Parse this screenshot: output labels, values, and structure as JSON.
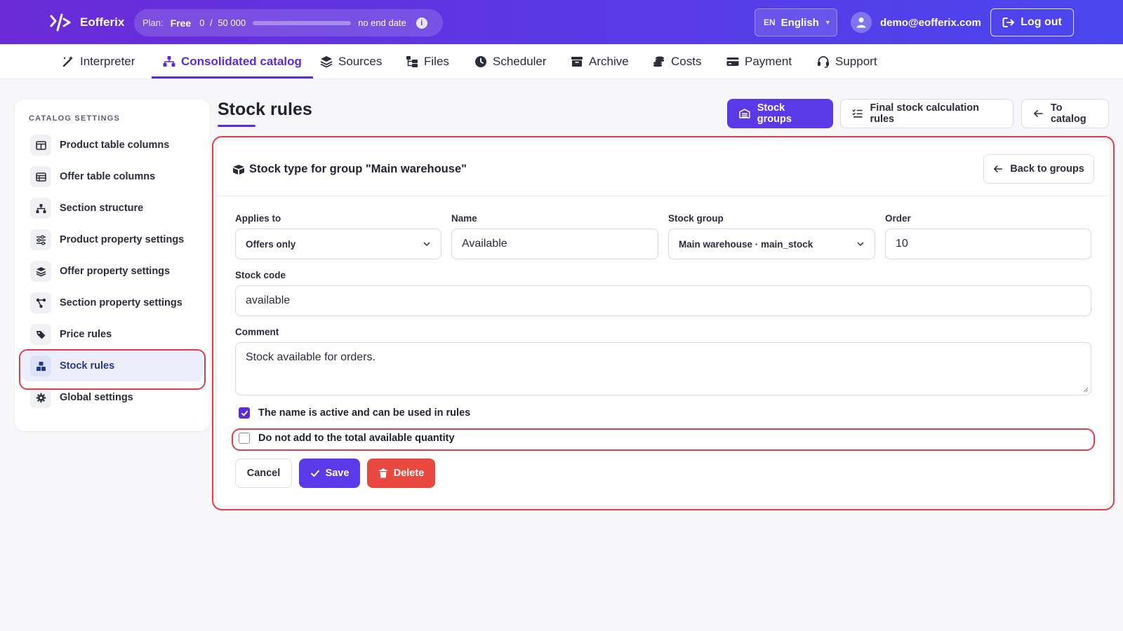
{
  "app": {
    "brand": "Eofferix"
  },
  "plan": {
    "label": "Plan:",
    "name": "Free",
    "used": "0",
    "separator": "/",
    "limit": "50 000",
    "usage_fraction": 0.0,
    "end": "no end date"
  },
  "lang": {
    "code": "EN",
    "name": "English"
  },
  "user": {
    "email": "demo@eofferix.com"
  },
  "logout_label": "Log out",
  "nav": [
    {
      "label": "Interpreter",
      "icon": "magic-wand-icon"
    },
    {
      "label": "Consolidated catalog",
      "icon": "sitemap-icon",
      "active": true
    },
    {
      "label": "Sources",
      "icon": "layers-icon"
    },
    {
      "label": "Files",
      "icon": "folder-tree-icon"
    },
    {
      "label": "Scheduler",
      "icon": "clock-icon"
    },
    {
      "label": "Archive",
      "icon": "archive-icon"
    },
    {
      "label": "Costs",
      "icon": "coins-icon"
    },
    {
      "label": "Payment",
      "icon": "credit-card-icon"
    },
    {
      "label": "Support",
      "icon": "headset-icon"
    }
  ],
  "sidebar": {
    "title": "CATALOG SETTINGS",
    "items": [
      {
        "label": "Product table columns",
        "icon": "columns-icon"
      },
      {
        "label": "Offer table columns",
        "icon": "table-icon"
      },
      {
        "label": "Section structure",
        "icon": "hierarchy-icon"
      },
      {
        "label": "Product property settings",
        "icon": "sliders-icon"
      },
      {
        "label": "Offer property settings",
        "icon": "layers-icon"
      },
      {
        "label": "Section property settings",
        "icon": "nodes-icon"
      },
      {
        "label": "Price rules",
        "icon": "tags-icon"
      },
      {
        "label": "Stock rules",
        "icon": "boxes-icon",
        "active": true
      },
      {
        "label": "Global settings",
        "icon": "gear-icon"
      }
    ]
  },
  "page": {
    "title": "Stock rules",
    "buttons": {
      "stock_groups": "Stock groups",
      "final_rules": "Final stock calculation rules",
      "to_catalog": "To catalog"
    }
  },
  "card": {
    "title": "Stock type for group \"Main warehouse\"",
    "back_label": "Back to groups"
  },
  "form": {
    "applies_to": {
      "label": "Applies to",
      "value": "Offers only"
    },
    "name": {
      "label": "Name",
      "value": "Available"
    },
    "stock_group": {
      "label": "Stock group",
      "value": "Main warehouse · main_stock"
    },
    "order": {
      "label": "Order",
      "value": "10"
    },
    "stock_code": {
      "label": "Stock code",
      "value": "available"
    },
    "comment": {
      "label": "Comment",
      "value": "Stock available for orders."
    },
    "active_check": {
      "label": "The name is active and can be used in rules",
      "checked": true
    },
    "exclude_check": {
      "label": "Do not add to the total available quantity",
      "checked": false
    }
  },
  "actions": {
    "cancel": "Cancel",
    "save": "Save",
    "delete": "Delete"
  },
  "colors": {
    "accent": "#5a3ae8",
    "danger": "#e8483e",
    "highlight": "#e43c4a"
  }
}
